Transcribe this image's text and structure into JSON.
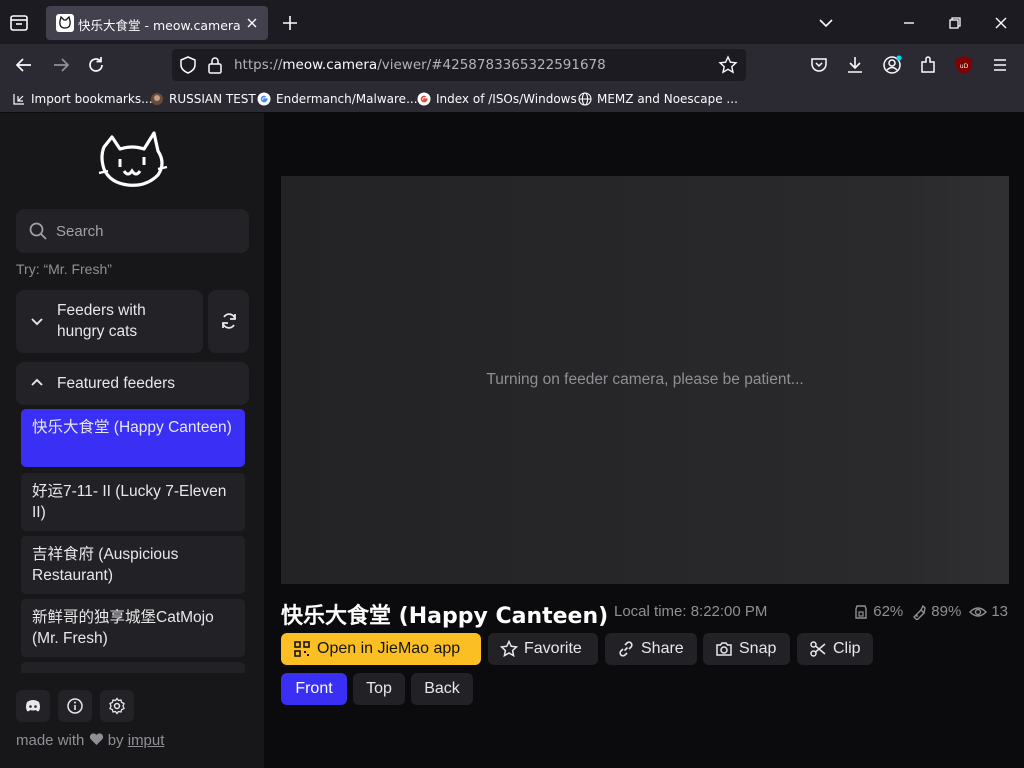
{
  "browser": {
    "tab": {
      "title": "快乐大食堂 - meow.camera"
    },
    "url": {
      "prefix": "https://",
      "host": "meow.camera",
      "path": "/viewer/#4258783365322591678"
    },
    "bookmarks": [
      {
        "label": "Import bookmarks..."
      },
      {
        "label": "RUSSIAN TEST"
      },
      {
        "label": "Endermanch/Malware..."
      },
      {
        "label": "Index of /ISOs/Windows"
      },
      {
        "label": "MEMZ and Noescape ..."
      }
    ]
  },
  "sidebar": {
    "search": {
      "placeholder": "Search"
    },
    "hint": "Try: “Mr. Fresh”",
    "sections": {
      "hungry": "Feeders with hungry cats",
      "featured": "Featured feeders"
    },
    "feeders": [
      {
        "name": "快乐大食堂 (Happy Canteen)",
        "active": true
      },
      {
        "name": "好运7-11- II  (Lucky 7-Eleven II)"
      },
      {
        "name": "吉祥食府 (Auspicious Restaurant)"
      },
      {
        "name": "新鲜哥的独享城堡CatMojo (Mr. Fresh)"
      },
      {
        "name": "…"
      }
    ],
    "footer": {
      "made_with": "made with",
      "by": "by",
      "author": "imput"
    }
  },
  "main": {
    "status_message": "Turning on feeder camera, please be patient...",
    "feeder_title": "快乐大食堂 (Happy Canteen)",
    "local_time": "Local time: 8:22:00 PM",
    "stats": {
      "food": "62%",
      "battery": "89%",
      "viewers": "13"
    },
    "actions": {
      "open_app": "Open in JieMao app",
      "favorite": "Favorite",
      "share": "Share",
      "snap": "Snap",
      "clip": "Clip"
    },
    "cameras": {
      "front": "Front",
      "top": "Top",
      "back": "Back",
      "selected": "Front"
    }
  },
  "colors": {
    "accent": "#3a2ff5",
    "open_app": "#fbbf24"
  }
}
